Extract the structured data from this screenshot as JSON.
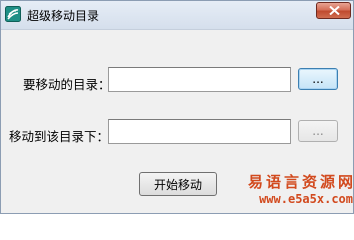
{
  "window": {
    "title": "超级移动目录",
    "close_icon": "close-icon",
    "app_icon": "app-logo-icon"
  },
  "form": {
    "source_label": "要移动的目录：",
    "source_value": "",
    "source_browse_label": "...",
    "target_label": "移动到该目录下：",
    "target_value": "",
    "target_browse_label": "..."
  },
  "actions": {
    "start_label": "开始移动"
  },
  "watermark": {
    "text": "易语言资源网",
    "url": "www.e5a5x.com"
  },
  "colors": {
    "close_button": "#c75a3e",
    "watermark": "#d24a1e",
    "title_bar": "#dbe4ef",
    "dialog_bg": "#f0f0f0"
  }
}
